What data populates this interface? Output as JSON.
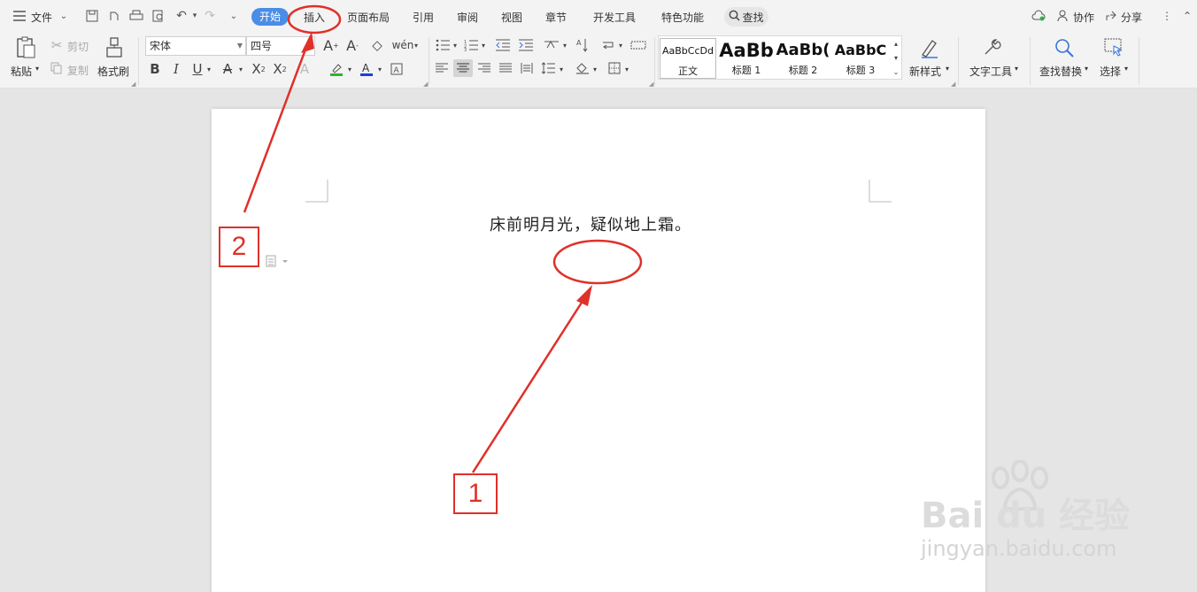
{
  "tabbar": {
    "file_label": "文件",
    "tabs": [
      "开始",
      "插入",
      "页面布局",
      "引用",
      "审阅",
      "视图",
      "章节",
      "开发工具",
      "特色功能"
    ],
    "search_label": "查找",
    "collaborate_label": "协作",
    "share_label": "分享"
  },
  "ribbon": {
    "paste": "粘贴",
    "cut": "剪切",
    "copy": "复制",
    "format_painter": "格式刷",
    "font_name": "宋体",
    "font_size": "四号",
    "styles": [
      {
        "preview": "AaBbCcDd",
        "name": "正文"
      },
      {
        "preview": "AaBb",
        "name": "标题 1"
      },
      {
        "preview": "AaBb(",
        "name": "标题 2"
      },
      {
        "preview": "AaBbC",
        "name": "标题 3"
      }
    ],
    "new_style": "新样式",
    "text_tools": "文字工具",
    "find_replace": "查找替换",
    "select": "选择"
  },
  "document": {
    "line1": "床前明月光，疑似地上霜。"
  },
  "annotations": {
    "label1": "1",
    "label2": "2"
  },
  "watermark": {
    "brand": "Bai du 经验",
    "url": "jingyan.baidu.com"
  },
  "colors": {
    "accent": "#4a8de6",
    "annotation_red": "#e0302a"
  }
}
